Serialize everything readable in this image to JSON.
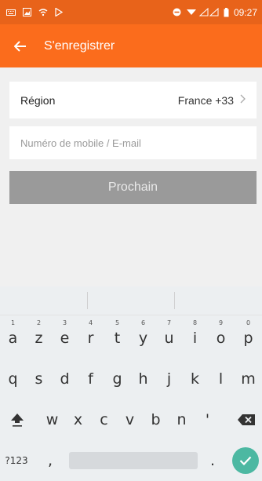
{
  "status_bar": {
    "time": "09:27",
    "icons_left": [
      "keyboard-icon",
      "image-icon",
      "wifi-icon",
      "play-store-icon"
    ],
    "icons_right": [
      "do-not-disturb-icon",
      "signal-icon",
      "battery-icon"
    ]
  },
  "app_bar": {
    "title": "S'enregistrer",
    "back_icon": "arrow-left-icon",
    "color": "#fb6c1c"
  },
  "form": {
    "region_label": "Région",
    "region_value": "France +33",
    "phone_placeholder": "Numéro de mobile / E-mail",
    "next_label": "Prochain"
  },
  "keyboard": {
    "row1": [
      {
        "num": "1",
        "letter": "a"
      },
      {
        "num": "2",
        "letter": "z"
      },
      {
        "num": "3",
        "letter": "e"
      },
      {
        "num": "4",
        "letter": "r"
      },
      {
        "num": "5",
        "letter": "t"
      },
      {
        "num": "6",
        "letter": "y"
      },
      {
        "num": "7",
        "letter": "u"
      },
      {
        "num": "8",
        "letter": "i"
      },
      {
        "num": "9",
        "letter": "o"
      },
      {
        "num": "0",
        "letter": "p"
      }
    ],
    "row2": [
      "q",
      "s",
      "d",
      "f",
      "g",
      "h",
      "j",
      "k",
      "l",
      "m"
    ],
    "row3": [
      "w",
      "x",
      "c",
      "v",
      "b",
      "n",
      "'"
    ],
    "row4": {
      "symbols_label": "?123",
      "comma": ",",
      "period": "."
    },
    "enter_color": "#4cb8a2"
  }
}
